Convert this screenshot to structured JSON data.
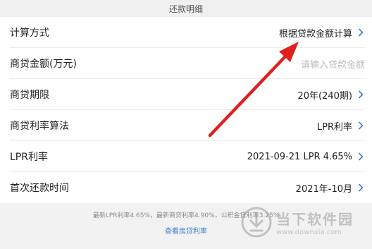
{
  "header": {
    "title": "还款明细"
  },
  "rows": [
    {
      "label": "计算方式",
      "value": "根据贷款金额计算",
      "placeholder": false
    },
    {
      "label": "商贷金额(万元)",
      "value": "请输入贷款金额",
      "placeholder": true
    },
    {
      "label": "商贷期限",
      "value": "20年(240期)",
      "placeholder": false
    },
    {
      "label": "商贷利率算法",
      "value": "LPR利率",
      "placeholder": false
    },
    {
      "label": "LPR利率",
      "value": "2021-09-21 LPR 4.65%",
      "placeholder": false
    },
    {
      "label": "首次还款时间",
      "value": "2021年-10月",
      "placeholder": false
    }
  ],
  "footer": {
    "note": "最新LPR利率4.65%，最新商贷利率4.90%，公积金贷利率3.25%",
    "link": "查看房贷利率"
  },
  "watermark": {
    "name": "当下软件园",
    "url": "www.downxia.com"
  },
  "colors": {
    "chevron": "#3a7bd5",
    "arrow": "#e0201c",
    "link": "#3a7bd5"
  }
}
